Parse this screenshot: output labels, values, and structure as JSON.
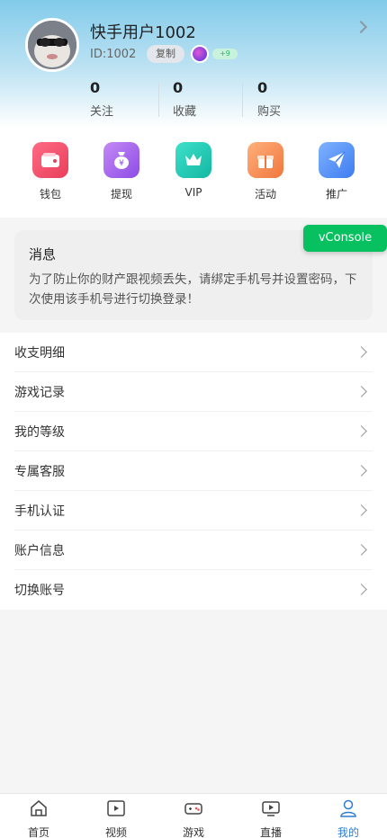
{
  "profile": {
    "username": "快手用户1002",
    "uid": "ID:1002",
    "copy_label": "复制",
    "level_tag": "+9"
  },
  "stats": [
    {
      "value": "0",
      "label": "关注"
    },
    {
      "value": "0",
      "label": "收藏"
    },
    {
      "value": "0",
      "label": "购买"
    }
  ],
  "quick_actions": [
    {
      "label": "钱包",
      "icon": "wallet-icon",
      "color": "#f0506e"
    },
    {
      "label": "提现",
      "icon": "money-bag-icon",
      "color": "#9b59e8"
    },
    {
      "label": "VIP",
      "icon": "crown-icon",
      "color": "#1bc7b3"
    },
    {
      "label": "活动",
      "icon": "gift-icon",
      "color": "#f28a4e"
    },
    {
      "label": "推广",
      "icon": "paper-plane-icon",
      "color": "#4f8df0"
    }
  ],
  "message": {
    "title": "消息",
    "text": "为了防止你的财产跟视频丢失，请绑定手机号并设置密码，下次使用该手机号进行切换登录！"
  },
  "vconsole_label": "vConsole",
  "menu": [
    {
      "label": "收支明细"
    },
    {
      "label": "游戏记录"
    },
    {
      "label": "我的等级"
    },
    {
      "label": "专属客服"
    },
    {
      "label": "手机认证"
    },
    {
      "label": "账户信息"
    },
    {
      "label": "切换账号"
    }
  ],
  "tabbar": [
    {
      "label": "首页",
      "icon": "home-icon"
    },
    {
      "label": "视频",
      "icon": "video-icon"
    },
    {
      "label": "游戏",
      "icon": "game-icon"
    },
    {
      "label": "直播",
      "icon": "live-icon"
    },
    {
      "label": "我的",
      "icon": "user-icon",
      "active": true
    }
  ],
  "colors": {
    "accent": "#2d7dd2",
    "vconsole": "#07c160"
  }
}
